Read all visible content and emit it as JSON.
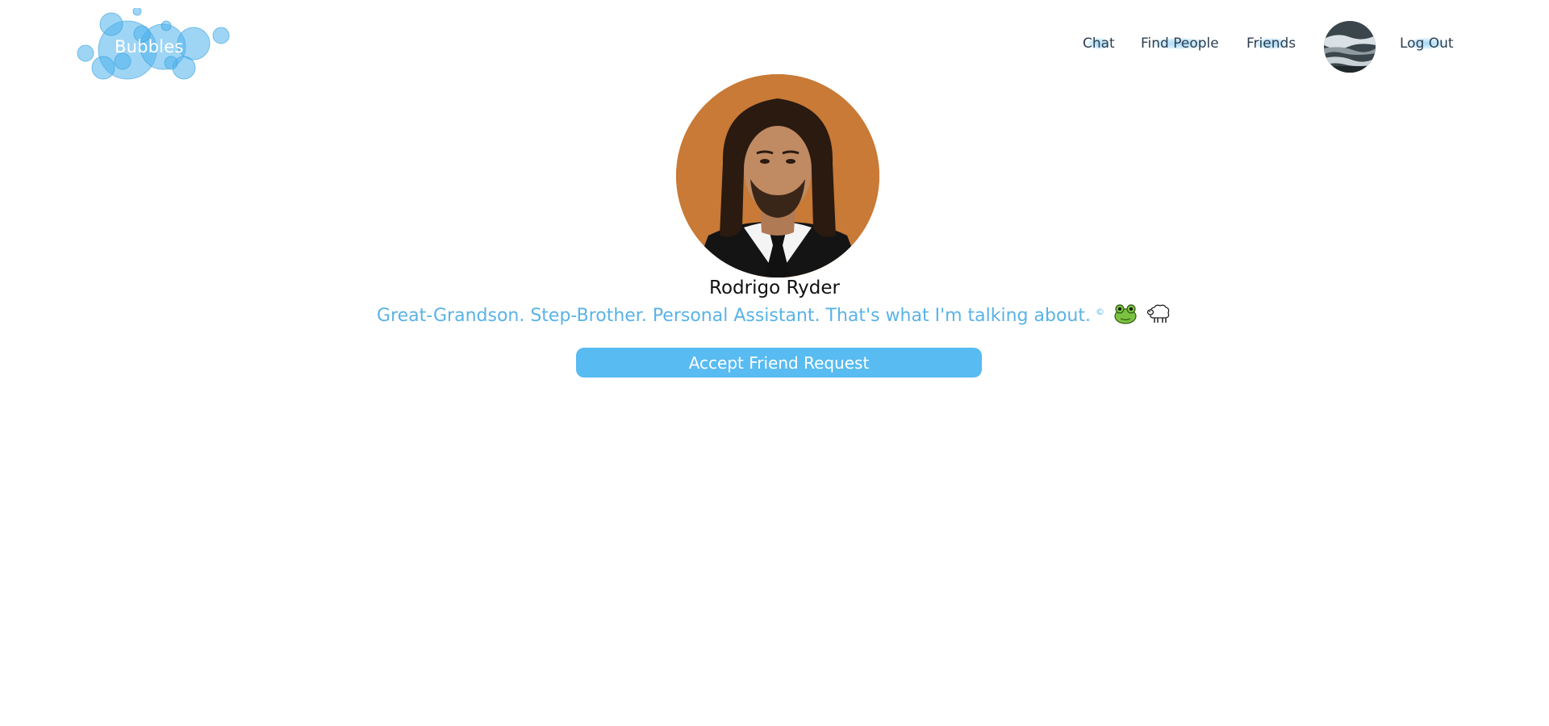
{
  "header": {
    "logo_text": "Bubbles",
    "nav": {
      "chat": "Chat",
      "find_people": "Find People",
      "friends": "Friends",
      "log_out": "Log Out"
    },
    "avatar_icon": "user-avatar-icon"
  },
  "profile": {
    "name": "Rodrigo Ryder",
    "bio": "Great-Grandson. Step-Brother. Personal Assistant. That's what I'm talking about.",
    "bio_mark": "©",
    "bio_emojis": [
      "frog-emoji",
      "sheep-emoji"
    ],
    "accept_button_label": "Accept Friend Request"
  },
  "colors": {
    "accent": "#58bbf1",
    "bio_text": "#5ab3e6",
    "nav_text": "#2c3e50",
    "name_text": "#111111"
  }
}
